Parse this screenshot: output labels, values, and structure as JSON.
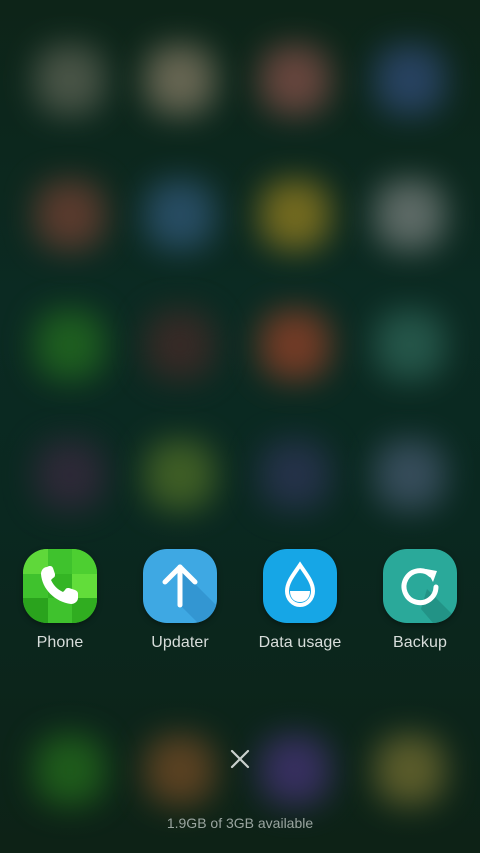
{
  "apps": [
    {
      "label": "Phone",
      "icon": "phone-icon",
      "color": "#3fc22d"
    },
    {
      "label": "Updater",
      "icon": "upload-arrow-icon",
      "color": "#3ea8e3"
    },
    {
      "label": "Data usage",
      "icon": "water-drop-icon",
      "color": "#16a6e6"
    },
    {
      "label": "Backup",
      "icon": "refresh-icon",
      "color": "#2aa99a"
    }
  ],
  "memory_status": "1.9GB of 3GB available",
  "background_blobs": [
    {
      "color": "#7a7a6a"
    },
    {
      "color": "#b09a80"
    },
    {
      "color": "#b0605a"
    },
    {
      "color": "#3e5a9a"
    },
    {
      "color": "#9a4a3a"
    },
    {
      "color": "#3e6a9a"
    },
    {
      "color": "#c8a020"
    },
    {
      "color": "#a0a0a0"
    },
    {
      "color": "#2e8a1e"
    },
    {
      "color": "#5a2a2a"
    },
    {
      "color": "#c84a2a"
    },
    {
      "color": "#3a7a6a"
    },
    {
      "color": "#4a2a4a"
    },
    {
      "color": "#6a8a2a"
    },
    {
      "color": "#3a3a6a"
    },
    {
      "color": "#5a6a8a"
    },
    {
      "color": "#2e8a1e"
    },
    {
      "color": "#9a5a2a"
    },
    {
      "color": "#5a3a9a"
    },
    {
      "color": "#9a8a3a"
    }
  ]
}
